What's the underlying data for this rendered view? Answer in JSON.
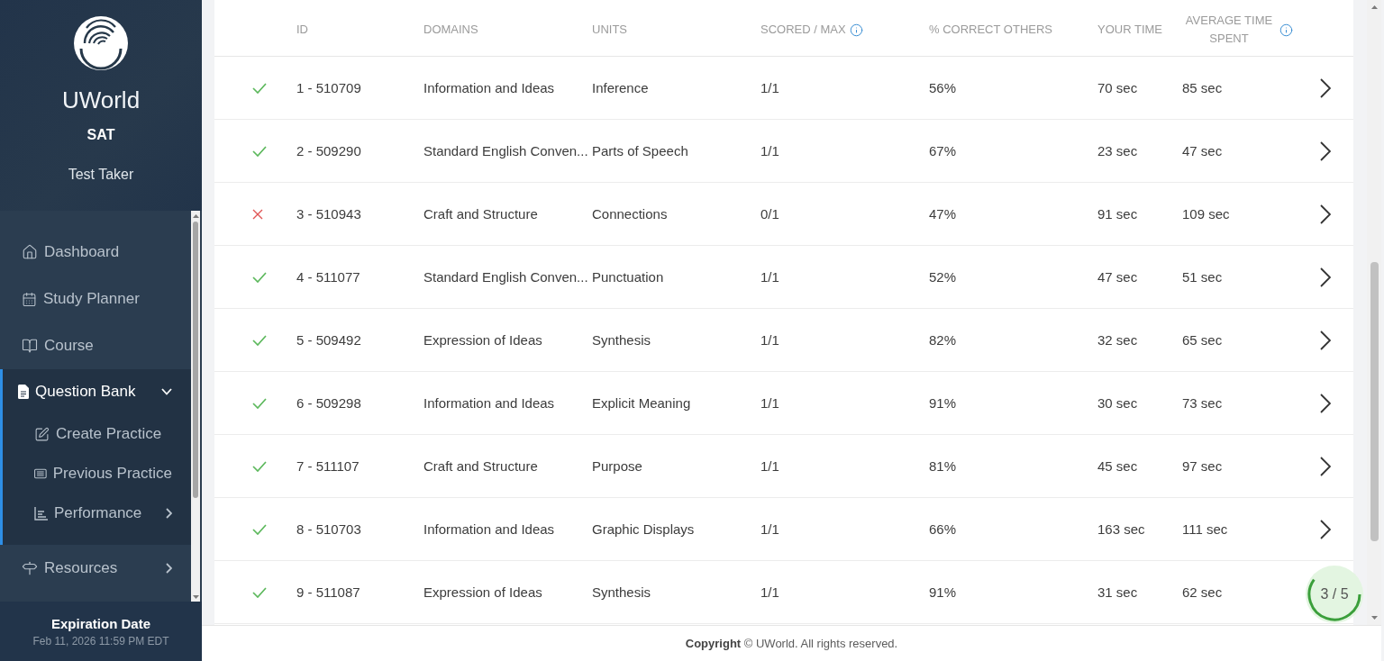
{
  "sidebar": {
    "brand": "UWorld",
    "product": "SAT",
    "user": "Test Taker",
    "nav": [
      {
        "label": "Dashboard",
        "selected": false
      },
      {
        "label": "Study Planner",
        "selected": false
      },
      {
        "label": "Course",
        "selected": false
      },
      {
        "label": "Question Bank",
        "selected": true,
        "expanded": true,
        "children": [
          {
            "label": "Create Practice",
            "selected": false
          },
          {
            "label": "Previous Practice",
            "selected": false
          },
          {
            "label": "Performance",
            "selected": false,
            "expanded": false
          }
        ]
      },
      {
        "label": "Resources",
        "selected": false,
        "expanded": false
      }
    ],
    "expiration_label": "Expiration Date",
    "expiration_date": "Feb 11, 2026 11:59 PM EDT"
  },
  "table": {
    "columns": [
      {
        "label": "ID",
        "info": false
      },
      {
        "label": "DOMAINS",
        "info": false
      },
      {
        "label": "UNITS",
        "info": false
      },
      {
        "label": "SCORED / MAX",
        "info": true
      },
      {
        "label": "% CORRECT OTHERS",
        "info": false
      },
      {
        "label": "YOUR TIME",
        "info": false
      },
      {
        "label": "AVERAGE TIME SPENT",
        "info": true
      }
    ],
    "rows": [
      {
        "correct": true,
        "id": "1 - 510709",
        "domain": "Information and Ideas",
        "unit": "Inference",
        "scored": "1/1",
        "correct_others": "56%",
        "your_time": "70 sec",
        "average_time": "85 sec"
      },
      {
        "correct": true,
        "id": "2 - 509290",
        "domain": "Standard English Conven...",
        "unit": "Parts of Speech",
        "scored": "1/1",
        "correct_others": "67%",
        "your_time": "23 sec",
        "average_time": "47 sec"
      },
      {
        "correct": false,
        "id": "3 - 510943",
        "domain": "Craft and Structure",
        "unit": "Connections",
        "scored": "0/1",
        "correct_others": "47%",
        "your_time": "91 sec",
        "average_time": "109 sec"
      },
      {
        "correct": true,
        "id": "4 - 511077",
        "domain": "Standard English Conven...",
        "unit": "Punctuation",
        "scored": "1/1",
        "correct_others": "52%",
        "your_time": "47 sec",
        "average_time": "51 sec"
      },
      {
        "correct": true,
        "id": "5 - 509492",
        "domain": "Expression of Ideas",
        "unit": "Synthesis",
        "scored": "1/1",
        "correct_others": "82%",
        "your_time": "32 sec",
        "average_time": "65 sec"
      },
      {
        "correct": true,
        "id": "6 - 509298",
        "domain": "Information and Ideas",
        "unit": "Explicit Meaning",
        "scored": "1/1",
        "correct_others": "91%",
        "your_time": "30 sec",
        "average_time": "73 sec"
      },
      {
        "correct": true,
        "id": "7 - 511107",
        "domain": "Craft and Structure",
        "unit": "Purpose",
        "scored": "1/1",
        "correct_others": "81%",
        "your_time": "45 sec",
        "average_time": "97 sec"
      },
      {
        "correct": true,
        "id": "8 - 510703",
        "domain": "Information and Ideas",
        "unit": "Graphic Displays",
        "scored": "1/1",
        "correct_others": "66%",
        "your_time": "163 sec",
        "average_time": "111 sec"
      },
      {
        "correct": true,
        "id": "9 - 511087",
        "domain": "Expression of Ideas",
        "unit": "Synthesis",
        "scored": "1/1",
        "correct_others": "91%",
        "your_time": "31 sec",
        "average_time": "62 sec"
      }
    ]
  },
  "progress_badge": {
    "text": "3 / 5"
  },
  "footer": {
    "text": "**Copyright** © UWorld. All rights reserved."
  }
}
